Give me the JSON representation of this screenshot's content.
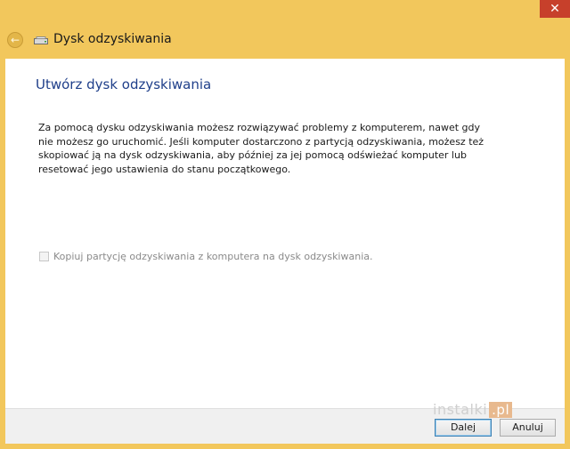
{
  "window": {
    "title": "Dysk odzyskiwania",
    "close_symbol": "✕",
    "back_symbol": "←"
  },
  "page": {
    "heading": "Utwórz dysk odzyskiwania",
    "description": "Za pomocą dysku odzyskiwania możesz rozwiązywać problemy z komputerem, nawet gdy nie możesz go uruchomić. Jeśli komputer dostarczono z partycją odzyskiwania, możesz też skopiować ją na dysk odzyskiwania, aby później za jej pomocą odświeżać komputer lub resetować jego ustawienia do stanu początkowego.",
    "option": {
      "label": "Kopiuj partycję odzyskiwania z komputera na dysk odzyskiwania.",
      "checked": false,
      "enabled": false
    }
  },
  "footer": {
    "next_label": "Dalej",
    "cancel_label": "Anuluj"
  },
  "watermark": {
    "text": "instalki",
    "suffix": ".pl"
  },
  "colors": {
    "accent": "#f2c75c",
    "heading": "#1f3f8a",
    "close": "#c7402b"
  },
  "icons": {
    "back": "back-arrow-icon",
    "drive": "drive-icon",
    "close": "close-icon"
  }
}
